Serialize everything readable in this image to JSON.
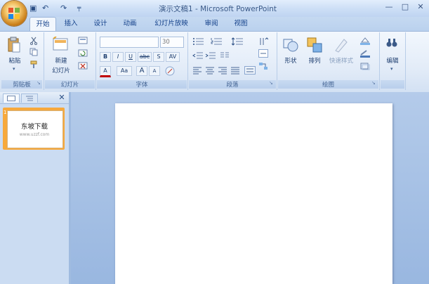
{
  "window": {
    "title": "演示文稿1 - Microsoft PowerPoint",
    "controls": [
      "—",
      "□",
      "✕"
    ]
  },
  "quick_access": {
    "save": "▣",
    "undo": "↶",
    "redo": "↷",
    "customize": "╤"
  },
  "ribbon": {
    "tabs": [
      "开始",
      "插入",
      "设计",
      "动画",
      "幻灯片放映",
      "审阅",
      "视图"
    ],
    "active_tab": "开始",
    "groups": {
      "clipboard": {
        "label": "剪贴板",
        "paste": "粘贴"
      },
      "slides": {
        "label": "幻灯片",
        "new_slide_line1": "新建",
        "new_slide_line2": "幻灯片"
      },
      "font": {
        "label": "字体",
        "font_size": "30",
        "buttons": [
          "B",
          "I",
          "U",
          "abc",
          "S",
          "AV"
        ],
        "row3": [
          "A",
          "Aa",
          "A",
          "A"
        ]
      },
      "paragraph": {
        "label": "段落"
      },
      "drawing": {
        "label": "绘图",
        "shapes": "形状",
        "arrange": "排列",
        "quick_styles": "快速样式"
      },
      "editing": {
        "label": "编辑"
      }
    }
  },
  "slide_panel": {
    "close": "✕",
    "slide_number": "1",
    "thumb_title": "东坡下载",
    "thumb_subtitle": "www.uzzf.com"
  }
}
